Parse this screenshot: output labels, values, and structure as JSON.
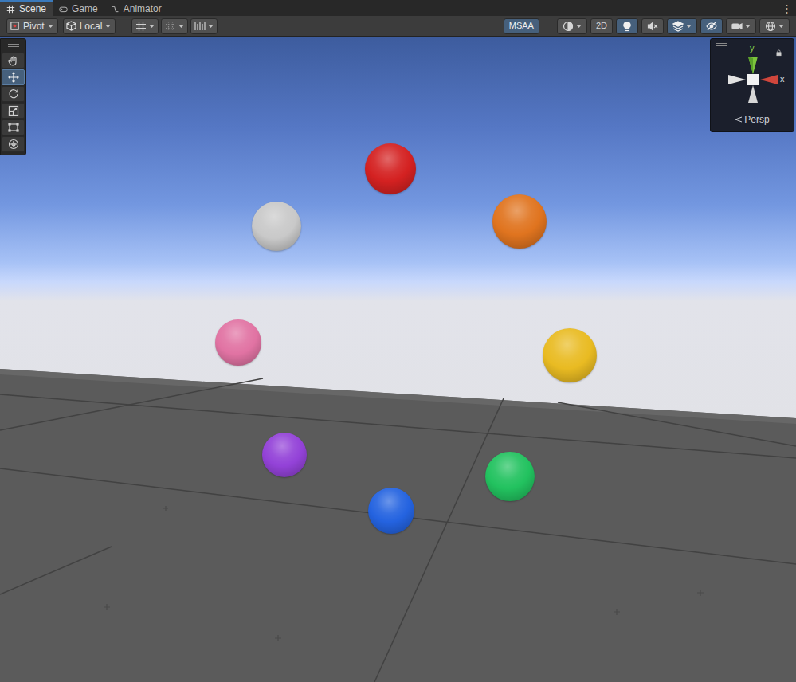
{
  "tabs": [
    {
      "label": "Scene",
      "kind": "scene",
      "selected": true
    },
    {
      "label": "Game",
      "kind": "game",
      "selected": false
    },
    {
      "label": "Animator",
      "kind": "animator",
      "selected": false
    }
  ],
  "window_menu": "⋮",
  "toolbar": {
    "pivot": {
      "label": "Pivot"
    },
    "space": {
      "label": "Local"
    },
    "snap_toggles": [
      {
        "kind": "grid",
        "on": false
      },
      {
        "kind": "increment",
        "on": false
      },
      {
        "kind": "ruler",
        "on": false
      }
    ],
    "view_buttons": [
      {
        "kind": "text",
        "label": "MSAA",
        "on": true,
        "dropdown": false
      },
      {
        "kind": "shading",
        "on": false,
        "dropdown": true
      },
      {
        "kind": "text",
        "label": "2D",
        "on": false,
        "dropdown": false
      },
      {
        "kind": "lighting",
        "on": true,
        "dropdown": false
      },
      {
        "kind": "audio",
        "on": false,
        "dropdown": false
      },
      {
        "kind": "effects",
        "on": true,
        "dropdown": true
      },
      {
        "kind": "visibility",
        "on": true,
        "dropdown": false
      },
      {
        "kind": "camera",
        "on": false,
        "dropdown": true
      },
      {
        "kind": "gizmos",
        "on": false,
        "dropdown": true
      }
    ]
  },
  "tools": [
    {
      "kind": "hand",
      "selected": false
    },
    {
      "kind": "move",
      "selected": true
    },
    {
      "kind": "rotate",
      "selected": false
    },
    {
      "kind": "scale",
      "selected": false
    },
    {
      "kind": "rect",
      "selected": false
    },
    {
      "kind": "transform",
      "selected": false
    }
  ],
  "gizmo": {
    "y": "y",
    "x": "x",
    "projection": "Persp"
  },
  "spheres": [
    {
      "color": "#d42121"
    },
    {
      "color": "#e0741f"
    },
    {
      "color": "#c9c9c9"
    },
    {
      "color": "#e173a3"
    },
    {
      "color": "#e9bb22"
    },
    {
      "color": "#9342d8"
    },
    {
      "color": "#22c25f"
    },
    {
      "color": "#2463e0"
    }
  ]
}
